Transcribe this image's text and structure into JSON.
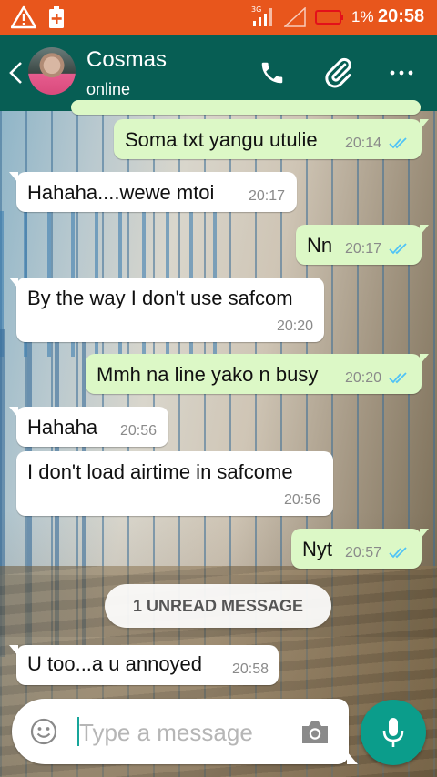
{
  "status_bar": {
    "network": "3G",
    "battery_percent": "1%",
    "time": "20:58"
  },
  "header": {
    "contact_name": "Cosmas",
    "presence": "online",
    "icons": [
      "back-arrow-icon",
      "avatar",
      "phone-icon",
      "paperclip-icon",
      "more-vert-icon"
    ]
  },
  "messages": [
    {
      "direction": "out",
      "text": "Soma txt yangu utulie",
      "time": "20:14",
      "status": "read"
    },
    {
      "direction": "in",
      "text": "Hahaha....wewe mtoi",
      "time": "20:17"
    },
    {
      "direction": "out",
      "text": "Nn",
      "time": "20:17",
      "status": "read"
    },
    {
      "direction": "in",
      "text": "By the way I don't use safcom",
      "time": "20:20"
    },
    {
      "direction": "out",
      "text": "Mmh na line yako n busy",
      "time": "20:20",
      "status": "read"
    },
    {
      "direction": "in",
      "text": "Hahaha",
      "time": "20:56"
    },
    {
      "direction": "in",
      "text": "I don't load airtime in safcome",
      "time": "20:56"
    },
    {
      "direction": "out",
      "text": "Nyt",
      "time": "20:57",
      "status": "read"
    },
    {
      "direction": "in",
      "text": "U too...a u annoyed",
      "time": "20:58"
    }
  ],
  "unread_banner": "1 UNREAD MESSAGE",
  "composer": {
    "placeholder": "Type a message",
    "value": ""
  },
  "colors": {
    "status_bar": "#e8561c",
    "header": "#075e54",
    "outgoing_bubble": "#dcf8c6",
    "incoming_bubble": "#ffffff",
    "read_ticks": "#4fc3f7",
    "mic_button": "#0b9d8b"
  }
}
